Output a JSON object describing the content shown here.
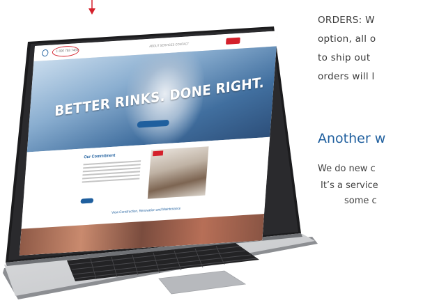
{
  "article": {
    "lines": [
      "ORDERS: W",
      "option, all o",
      "to  ship  out",
      "orders  will  l"
    ],
    "heading": "Another w",
    "lines2": [
      "We do new c",
      "It’s a service",
      "some c"
    ]
  },
  "website": {
    "phone": "1 800 788 7465",
    "nav_links": "ABOUT   SERVICES   CONTACT",
    "hero_title": "BETTER RINKS. DONE RIGHT.",
    "commitment_title": "Our Commitment",
    "latest_title": "View Construction, Renovation and Maintenance"
  },
  "colors": {
    "accent_red": "#d4202b",
    "brand_blue": "#1f5f9e",
    "heading_blue": "#1f5f9e",
    "body_text": "#3a3a3a"
  }
}
